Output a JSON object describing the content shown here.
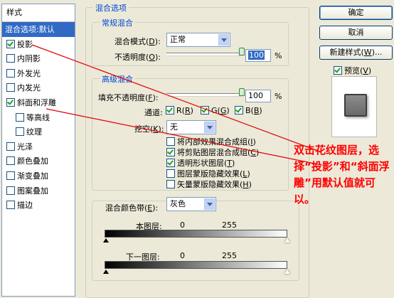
{
  "styles_panel": {
    "header": "样式",
    "items": [
      {
        "label": "混合选项:默认",
        "checkbox": false,
        "checked": false,
        "active": true
      },
      {
        "label": "投影",
        "checkbox": true,
        "checked": true,
        "active": false
      },
      {
        "label": "内阴影",
        "checkbox": true,
        "checked": false,
        "active": false
      },
      {
        "label": "外发光",
        "checkbox": true,
        "checked": false,
        "active": false
      },
      {
        "label": "内发光",
        "checkbox": true,
        "checked": false,
        "active": false
      },
      {
        "label": "斜面和浮雕",
        "checkbox": true,
        "checked": true,
        "active": false
      },
      {
        "label": "等高线",
        "checkbox": true,
        "checked": false,
        "active": false,
        "indent": true
      },
      {
        "label": "纹理",
        "checkbox": true,
        "checked": false,
        "active": false,
        "indent": true
      },
      {
        "label": "光泽",
        "checkbox": true,
        "checked": false,
        "active": false
      },
      {
        "label": "颜色叠加",
        "checkbox": true,
        "checked": false,
        "active": false
      },
      {
        "label": "渐变叠加",
        "checkbox": true,
        "checked": false,
        "active": false
      },
      {
        "label": "图案叠加",
        "checkbox": true,
        "checked": false,
        "active": false
      },
      {
        "label": "描边",
        "checkbox": true,
        "checked": false,
        "active": false
      }
    ]
  },
  "blending": {
    "title": "混合选项",
    "general": {
      "title": "常规混合",
      "mode_label": "混合模式",
      "mode_key": "D",
      "mode_value": "正常",
      "opacity_label": "不透明度",
      "opacity_key": "O",
      "opacity_value": "100",
      "opacity_unit": "%",
      "opacity_level": 1.0
    },
    "advanced": {
      "title": "高级混合",
      "fill_label": "填充不透明度",
      "fill_key": "F",
      "fill_value": "100",
      "fill_unit": "%",
      "fill_level": 1.0,
      "channels_label": "通道",
      "channels": [
        {
          "label": "R",
          "key": "R",
          "checked": true
        },
        {
          "label": "G",
          "key": "G",
          "checked": true
        },
        {
          "label": "B",
          "key": "B",
          "checked": true
        }
      ],
      "knockout_label": "挖空",
      "knockout_key": "K",
      "knockout_value": "无",
      "options": [
        {
          "label": "将内部效果混合成组",
          "key": "I",
          "checked": false
        },
        {
          "label": "将剪贴图层混合成组",
          "key": "C",
          "checked": true
        },
        {
          "label": "透明形状图层",
          "key": "T",
          "checked": true
        },
        {
          "label": "图层蒙版隐藏效果",
          "key": "L",
          "checked": false
        },
        {
          "label": "矢量蒙版隐藏效果",
          "key": "H",
          "checked": false
        }
      ]
    },
    "blend_if": {
      "label": "混合颜色带",
      "key": "E",
      "value": "灰色",
      "this_layer": {
        "label": "本图层:",
        "low": "0",
        "high": "255"
      },
      "underlying": {
        "label": "下一图层:",
        "low": "0",
        "high": "255"
      }
    }
  },
  "buttons": {
    "ok": "确定",
    "cancel": "取消",
    "new_style": "新建样式",
    "new_style_key": "W",
    "new_style_suffix": "...",
    "preview_label": "预览",
    "preview_key": "V",
    "preview_checked": true
  },
  "annotation": {
    "text": "双击花纹图层，选择“投影”和“斜面浮雕”用默认值就可以。",
    "color": "#ff0000"
  },
  "colors": {
    "accent": "#316ac5",
    "group_title": "#0046d5",
    "annotation": "#ff0000",
    "dialog_bg": "#ece9d8"
  }
}
